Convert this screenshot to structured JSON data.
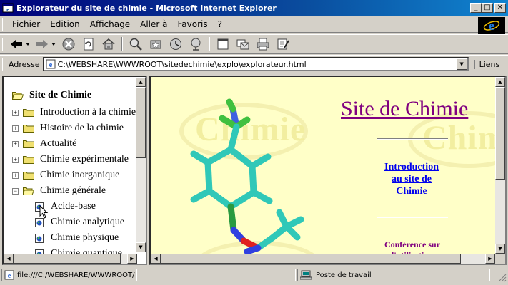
{
  "window": {
    "title": "Explorateur du site de chimie - Microsoft Internet Explorer",
    "min_symbol": "_",
    "max_symbol": "□",
    "close_symbol": "✕"
  },
  "menubar": {
    "items": [
      {
        "label": "Fichier",
        "key": "F"
      },
      {
        "label": "Edition",
        "key": "E"
      },
      {
        "label": "Affichage",
        "key": "h"
      },
      {
        "label": "Aller à",
        "key": "A"
      },
      {
        "label": "Favoris",
        "key": "v"
      },
      {
        "label": "?",
        "key": "?"
      }
    ]
  },
  "toolbar": {
    "buttons": [
      "back-icon",
      "forward-icon",
      "stop-icon",
      "refresh-icon",
      "home-icon",
      "search-icon",
      "favorites-icon",
      "history-icon",
      "channels-icon",
      "fullscreen-icon",
      "mail-icon",
      "print-icon",
      "edit-icon"
    ]
  },
  "addressbar": {
    "label": "Adresse",
    "url": "C:\\WEBSHARE\\WWWROOT\\sitedechimie\\explo\\explorateur.html",
    "links_label": "Liens"
  },
  "tree": {
    "root": "Site de Chimie",
    "folders": [
      {
        "label": "Introduction à la chimie",
        "expanded": false
      },
      {
        "label": "Histoire de la chimie",
        "expanded": false
      },
      {
        "label": "Actualité",
        "expanded": false
      },
      {
        "label": "Chimie expérimentale",
        "expanded": false
      },
      {
        "label": "Chimie inorganique",
        "expanded": false
      },
      {
        "label": "Chimie générale",
        "expanded": true
      }
    ],
    "leaves": [
      "Acide-base",
      "Chimie analytique",
      "Chimie physique",
      "Chimie quantique"
    ]
  },
  "content": {
    "title": "Site de Chimie",
    "intro_link": "Introduction au site de Chimie",
    "conference_link": "Conférence sur l'utilisation",
    "watermark": "Chimie"
  },
  "statusbar": {
    "url": "file:///C:/WEBSHARE/WWWROOT/",
    "zone": "Poste de travail"
  },
  "colors": {
    "title_gradient_start": "#00007b",
    "content_bg": "#ffffc8",
    "site_title": "#800080",
    "link": "#0000ee"
  }
}
